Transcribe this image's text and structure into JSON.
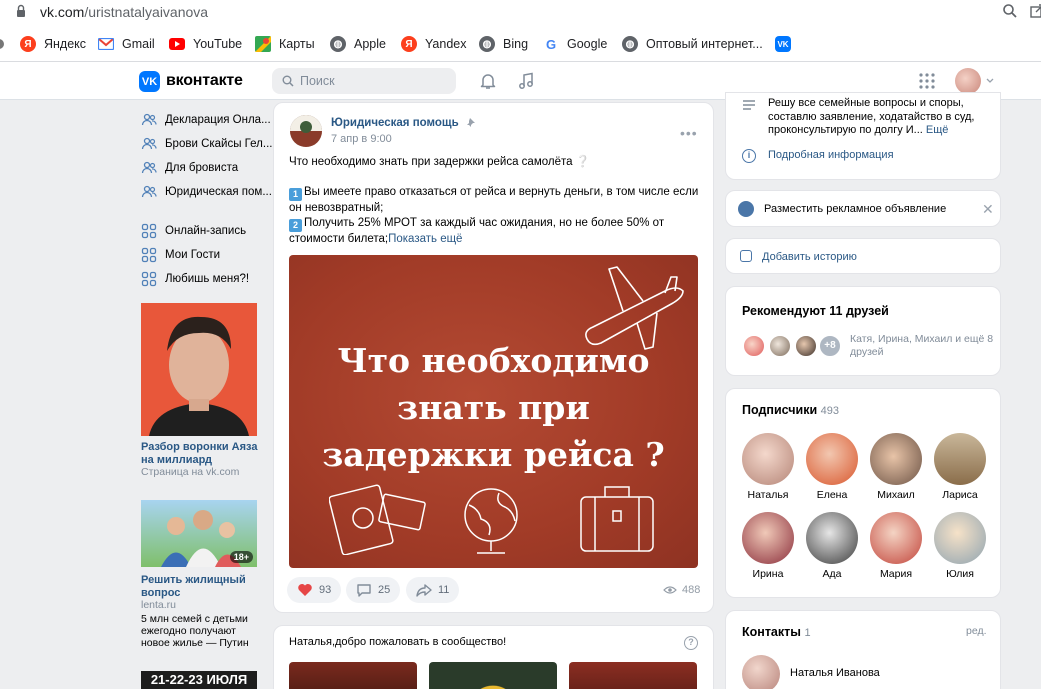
{
  "browser": {
    "url_host": "vk.com",
    "url_path": "/uristnatalyaivanova",
    "bookmarks": [
      {
        "label": "Яндекс",
        "icon": "yandex-icon"
      },
      {
        "label": "Gmail",
        "icon": "gmail-icon"
      },
      {
        "label": "YouTube",
        "icon": "youtube-icon"
      },
      {
        "label": "Карты",
        "icon": "maps-icon"
      },
      {
        "label": "Apple",
        "icon": "globe-icon"
      },
      {
        "label": "Yandex",
        "icon": "yandex-icon"
      },
      {
        "label": "Bing",
        "icon": "globe-icon"
      },
      {
        "label": "Google",
        "icon": "google-icon"
      },
      {
        "label": "Оптовый интернет...",
        "icon": "globe-icon"
      },
      {
        "label": "",
        "icon": "vk-icon"
      }
    ]
  },
  "header": {
    "logo_mark": "VK",
    "logo_text": "вконтакте",
    "search_placeholder": "Поиск"
  },
  "sidebar": {
    "groups": [
      "Декларация Онла...",
      "Брови Скайсы Гел...",
      "Для бровиста",
      "Юридическая пом..."
    ],
    "apps": [
      "Онлайн-запись",
      "Мои Гости",
      "Любишь меня?!"
    ],
    "ad1": {
      "title": "Разбор воронки Аяза на миллиард",
      "subtitle": "Страница на vk.com"
    },
    "ad2": {
      "age": "18+",
      "title": "Решить жилищный вопрос",
      "source": "lenta.ru",
      "text": "5 млн семей с детьми ежегодно получают новое жилье — Путин"
    },
    "ad3": {
      "text": "21-22-23 ИЮЛЯ"
    }
  },
  "post": {
    "author": "Юридическая помощь",
    "date": "7 апр в 9:00",
    "line1": "Что необходимо знать при задержки рейса самолёта ❔",
    "item1_num": "1",
    "item1": "Вы имеете право отказаться от рейса и вернуть деньги, в том числе если он невозвратный;",
    "item2_num": "2",
    "item2": "Получить 25% МРОТ за каждый час ожидания, но не более 50% от стоимости билета;",
    "show_more": "Показать ещё",
    "image_text": [
      "Что необходимо",
      "знать при",
      "задержки рейса ?"
    ],
    "likes": "93",
    "comments": "25",
    "shares": "11",
    "views": "488"
  },
  "post2": {
    "text": "Наталья,добро пожаловать в сообщество!"
  },
  "right": {
    "info_text": "Решу все семейные вопросы и споры, составлю заявление, ходатайство в суд, проконсультирую по долгу И...",
    "info_more": "Ещё",
    "info_link": "Подробная информация",
    "ad_label": "Разместить рекламное объявление",
    "story_label": "Добавить историю",
    "rec_title": "Рекомендуют 11 друзей",
    "rec_more": "+8",
    "rec_text": "Катя, Ирина, Михаил и ещё 8 друзей",
    "subs_title": "Подписчики",
    "subs_count": "493",
    "subscribers": [
      "Наталья",
      "Елена",
      "Михаил",
      "Лариса",
      "Ирина",
      "Ада",
      "Мария",
      "Юлия"
    ],
    "contacts_title": "Контакты",
    "contacts_count": "1",
    "contacts_edit": "ред.",
    "contact_name": "Наталья Иванова"
  },
  "colors": {
    "vk_blue": "#0077ff",
    "link": "#2a5885",
    "post_image_bg": "#a13b27",
    "page_bg": "#edeef0"
  }
}
